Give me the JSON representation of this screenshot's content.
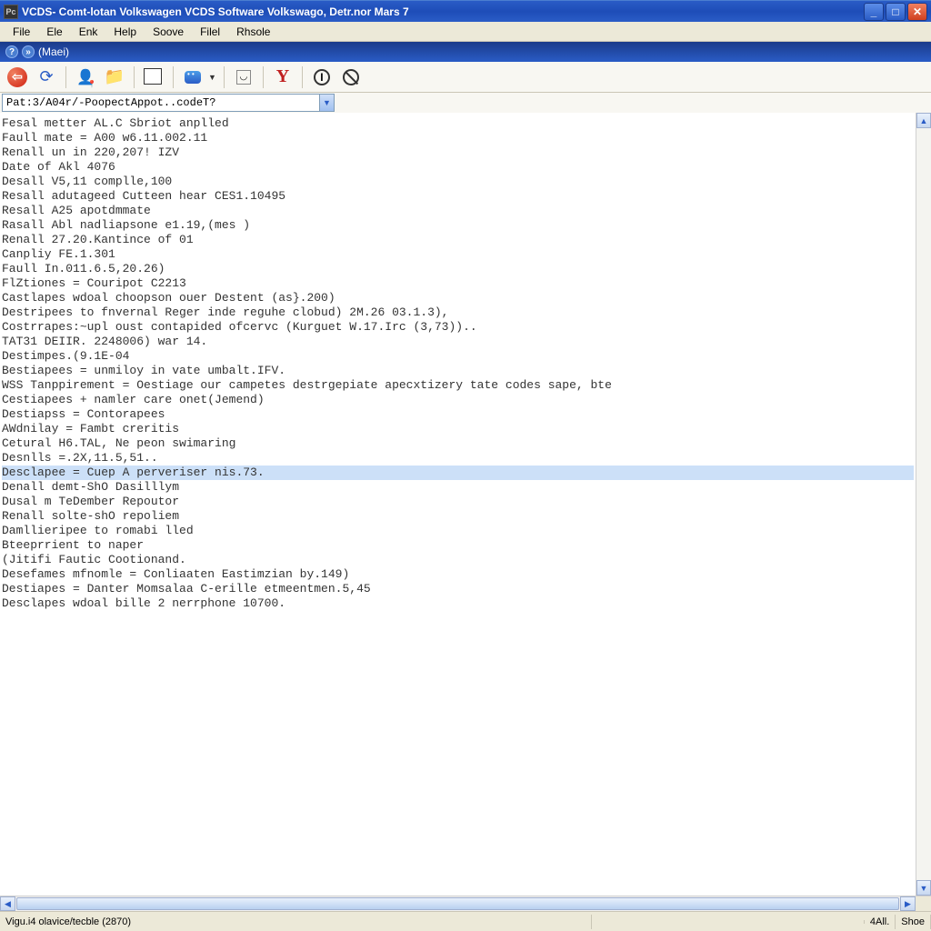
{
  "window": {
    "title": "VCDS- Comt-lotan Volkswagen VCDS Software Volkswago, Detr.nor Mars 7",
    "app_icon_text": "Pc"
  },
  "menu": [
    "File",
    "Ele",
    "Enk",
    "Help",
    "Soove",
    "Filel",
    "Rhsole"
  ],
  "subbar": {
    "label": "(Maei)"
  },
  "toolbar_names": [
    "back",
    "refresh",
    "person",
    "folder",
    "copy",
    "face",
    "face-dd",
    "gift",
    "y",
    "power",
    "ban"
  ],
  "addressbar": {
    "path": "Pat:3/A04r/-PoopectAppot..codeT?"
  },
  "content": {
    "lines": [
      "Fesal metter AL.C Sbriot anplled",
      "Faull mate = A00 w6.11.002.11",
      "Renall un in 220,207! IZV",
      "Date of Akl 4076",
      "",
      "Desall V5,11 complle,100",
      "Resall adutageed Cutteen hear CES1.10495",
      "Resall A25 apotdmmate",
      "Rasall Abl nadliapsone e1.19,(mes )",
      "Renall 27.20.Kantince of 01",
      "",
      "Canpliy FE.1.301",
      "Faull In.011.6.5,20.26)",
      "FlZtiones = Couripot C2213",
      "Castlapes wdoal choopson ouer Destent (as}.200)",
      "Destripees to fnvernal Reger inde reguhe clobud) 2M.26 03.1.3),",
      "Costrrapes:~upl oust contapided ofcervc (Kurguet W.17.Irc (3,73))..",
      "TAT31 DEIIR. 2248006) war 14.",
      "Destimpes.(9.1E-04",
      "",
      "Bestiapees = unmiloy in vate umbalt.IFV.",
      "WSS Tanppirement = Oestiage our campetes destrgepiate apecxtizery tate codes sape, bte",
      "Cestiapees + namler care onet(Jemend)",
      "Destiapss = Contorapees",
      "AWdnilay = Fambt creritis",
      "Cetural H6.TAL, Ne peon swimaring",
      "Desnlls =.2X,11.5,51..",
      "Denall demt-ShO Dasilllym",
      "Dusal m TeDember Repoutor",
      "Renall solte-shO repoliem",
      "Damllieripee to romabi lled",
      "Bteeprrient to naper",
      "(Jitifi Fautic Cootionand.",
      "Desefames mfnomle = Conliaaten Eastimzian by.149)",
      "Destiapes = Danter Momsalaa C-erille etmeentmen.5,45",
      "Desclapes wdoal bille 2 nerrphone 10700."
    ],
    "highlight_index": 27,
    "highlight_text": "Desclapee = Cuep A perveriser nis.73."
  },
  "status": {
    "main": "Vigu.i4 olavice/tecble (2870)",
    "mid": "",
    "right1": "4All.",
    "right2": "Shoe"
  }
}
